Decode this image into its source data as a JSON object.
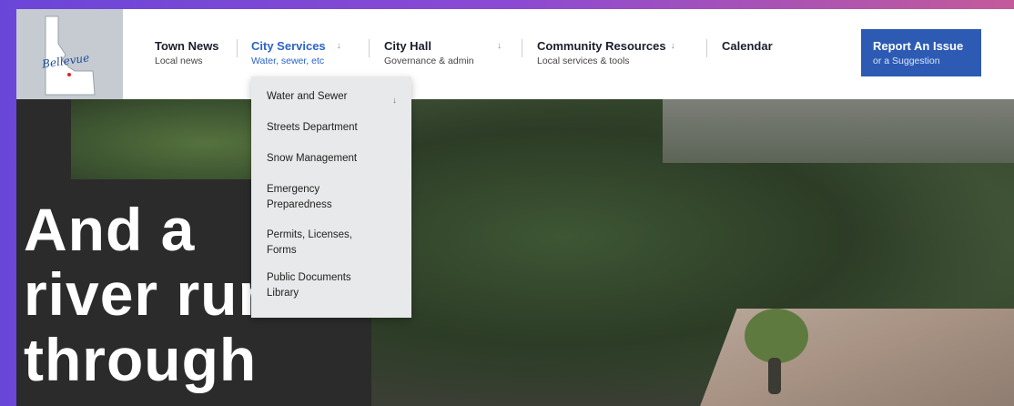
{
  "nav": {
    "items": [
      {
        "title": "Town News",
        "sub": "Local news"
      },
      {
        "title": "City Services",
        "sub": "Water, sewer, etc",
        "arrow": "↓"
      },
      {
        "title": "City Hall",
        "sub": "Governance & admin",
        "arrow": "↓"
      },
      {
        "title": "Community Resources",
        "sub": "Local services & tools",
        "arrow": "↓"
      },
      {
        "title": "Calendar",
        "sub": ""
      }
    ],
    "report": {
      "title": "Report An Issue",
      "sub": "or a Suggestion"
    },
    "logo_text": "Bellevue"
  },
  "dropdown": {
    "items": [
      "Water and Sewer",
      "Streets Department",
      "Snow Management",
      "Emergency Preparedness",
      "Permits, Licenses, Forms",
      "Public Documents Library"
    ],
    "arrow": "↓"
  },
  "hero": {
    "line1": "And a",
    "line2": "river runs",
    "line3": "through"
  },
  "colors": {
    "accent": "#2a63c9",
    "report_button": "#2d5bb3",
    "dropdown_bg": "#e8e9ea"
  }
}
